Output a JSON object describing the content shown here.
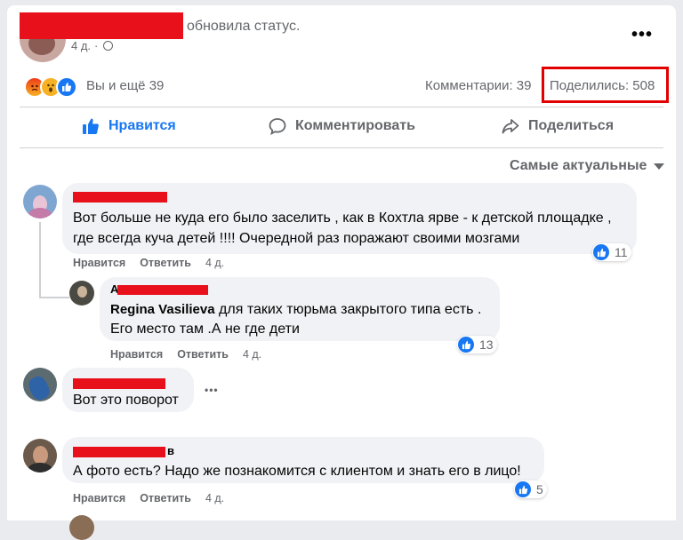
{
  "post": {
    "status_text": "обновила статус.",
    "time": "4 д.",
    "more": "•••"
  },
  "stats": {
    "reactions_text": "Вы и ещё 39",
    "comments": "Комментарии: 39",
    "shares": "Поделились: 508"
  },
  "actions": {
    "like": "Нравится",
    "comment": "Комментировать",
    "share": "Поделиться"
  },
  "sort_label": "Самые актуальные",
  "comments": [
    {
      "text_line1": "Вот больше не куда его было заселить , как в Кохтла ярве - к детской площадке ,",
      "text_line2": "где всегда куча детей !!!! Очередной раз поражают своими мозгами",
      "like": "Нравится",
      "reply": "Ответить",
      "time": "4 д.",
      "likes": "11"
    },
    {
      "name_prefix": "А",
      "mention": "Regina Vasilieva",
      "text_line1": "для таких тюрьма закрытого типа есть .",
      "text_line2": "Его место там .А не где дети",
      "like": "Нравится",
      "reply": "Ответить",
      "time": "4 д.",
      "likes": "13"
    },
    {
      "text": "Вот это поворот",
      "more": "•••"
    },
    {
      "name_suffix": "в",
      "text": "А фото есть? Надо же познакомится с клиентом и знать его в лицо!",
      "like": "Нравится",
      "reply": "Ответить",
      "time": "4 д.",
      "likes": "5"
    }
  ]
}
